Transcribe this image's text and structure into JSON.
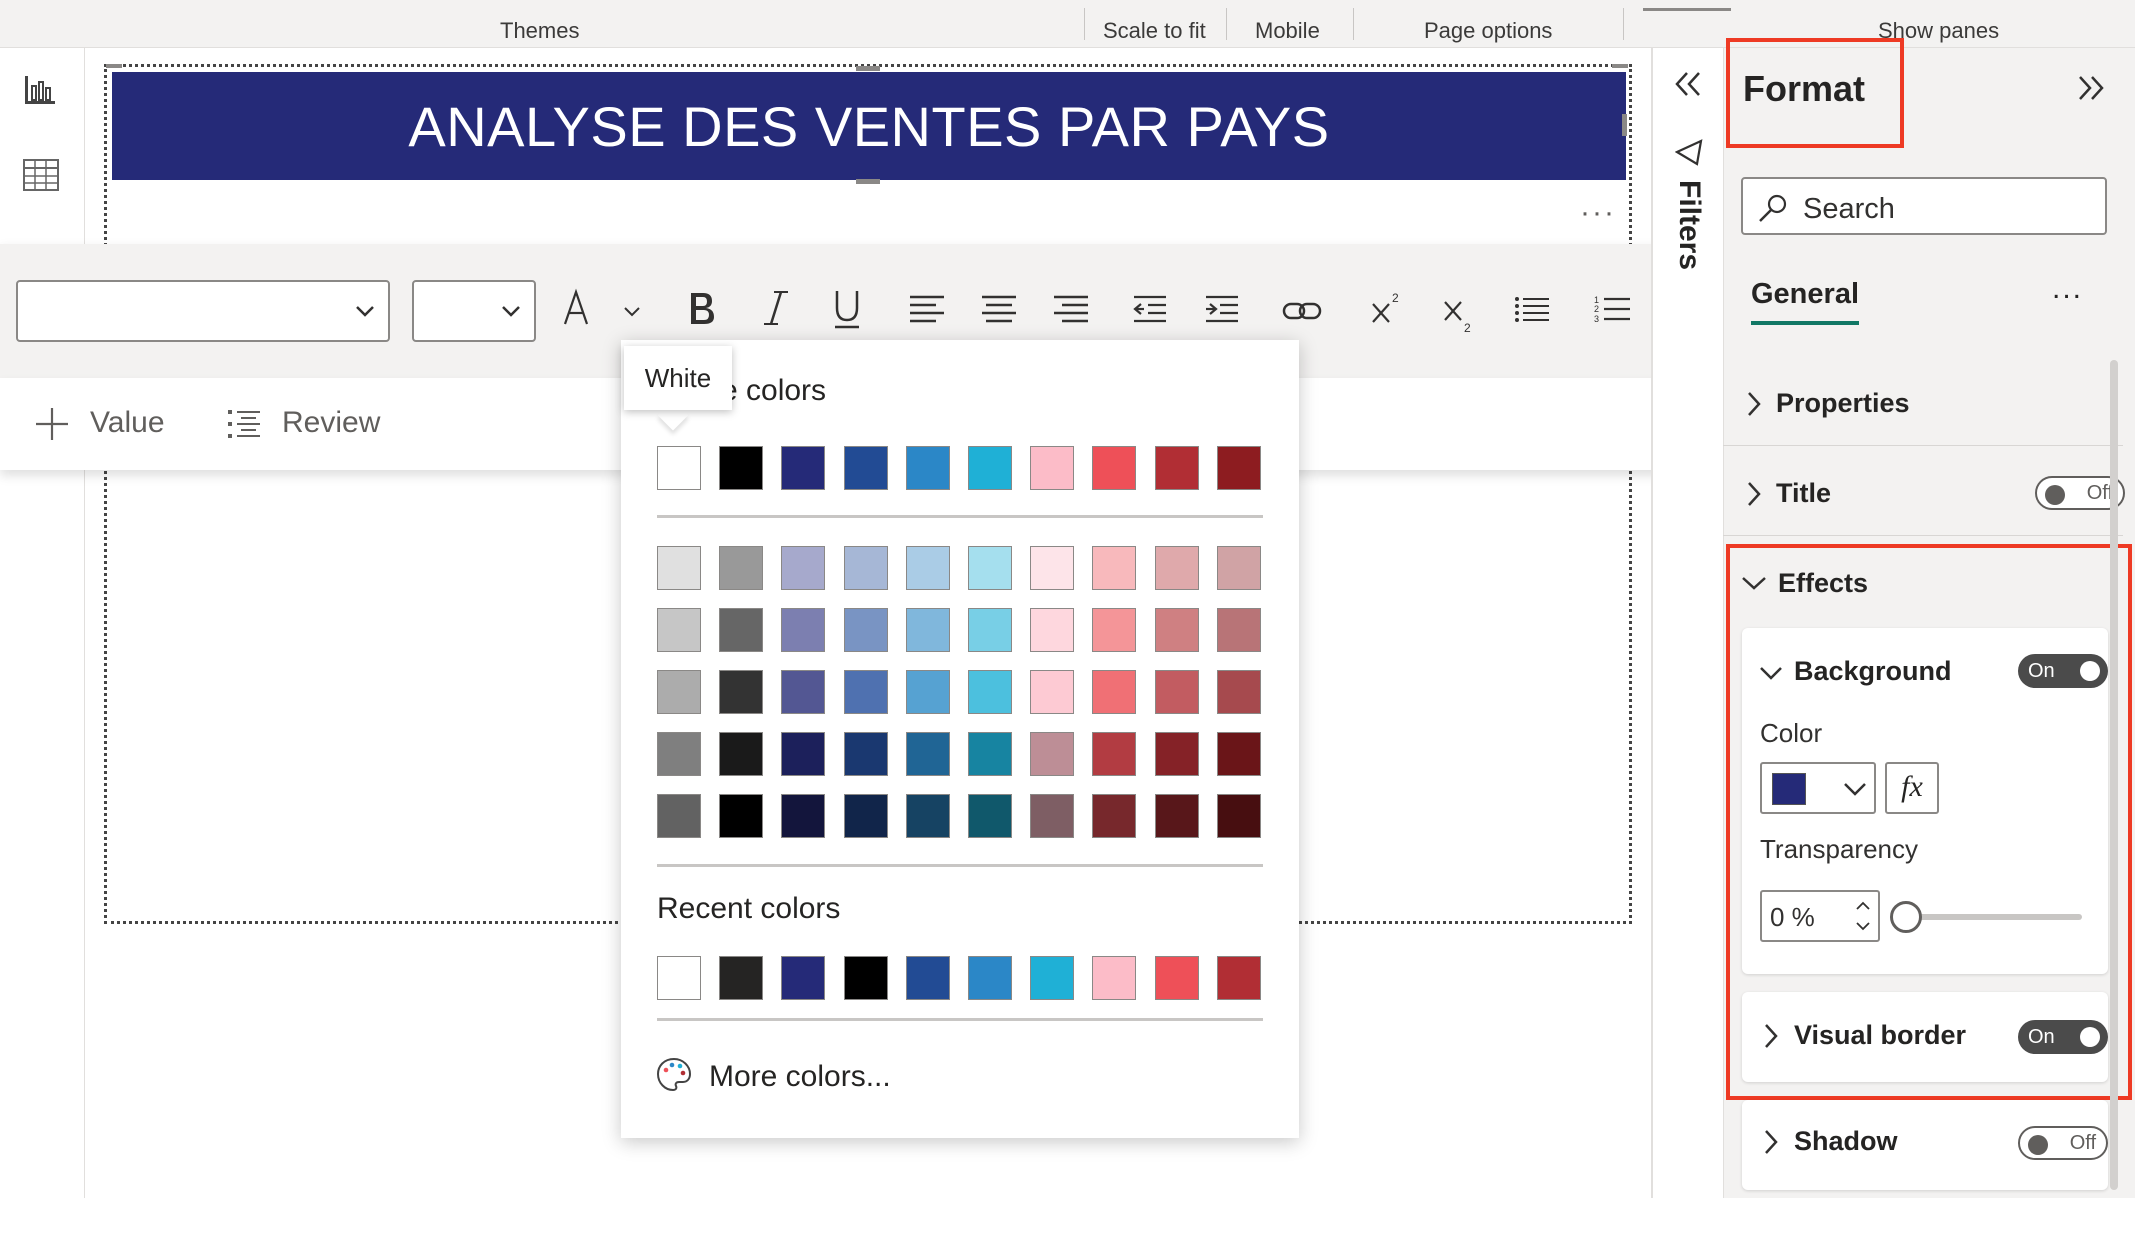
{
  "ribbon": {
    "themes": "Themes",
    "scale_to_fit": "Scale to fit",
    "mobile": "Mobile",
    "page_options": "Page options",
    "show_panes": "Show panes"
  },
  "canvas": {
    "banner_title": "ANALYSE DES VENTES PAR PAYS",
    "banner_color": "#252a78"
  },
  "toolbar": {
    "font_family_value": "",
    "font_size_value": "",
    "value_button": "Value",
    "review_button": "Review"
  },
  "color_picker": {
    "tooltip": "White",
    "theme_colors_title": "Theme colors",
    "theme_colors_visible_title": "e colors",
    "theme_top_row": [
      "#ffffff",
      "#000000",
      "#252a78",
      "#224b94",
      "#2b87c7",
      "#1fb0d6",
      "#fcbcc8",
      "#ee5058",
      "#b12e34",
      "#8d1c20"
    ],
    "theme_shades": [
      [
        "#e0e0e0",
        "#999999",
        "#a6a9cc",
        "#a6b7d6",
        "#aacce6",
        "#a5dfee",
        "#fde4e9",
        "#f8b9bc",
        "#dfa9ab",
        "#d0a3a5"
      ],
      [
        "#c6c6c6",
        "#666666",
        "#7c7fb0",
        "#7994c3",
        "#80b7dc",
        "#78cfe6",
        "#fed7de",
        "#f49598",
        "#cf8082",
        "#b87477"
      ],
      [
        "#acacac",
        "#333333",
        "#535793",
        "#4f71b0",
        "#56a2d2",
        "#4cc0de",
        "#fdcad3",
        "#f07075",
        "#c25c61",
        "#a64a4e"
      ],
      [
        "#7f7f7f",
        "#1a1a1a",
        "#1c205b",
        "#1a3870",
        "#206595",
        "#1784a1",
        "#bd8e96",
        "#b23c42",
        "#852227",
        "#6a1518"
      ],
      [
        "#626262",
        "#000000",
        "#13153c",
        "#11254a",
        "#164363",
        "#10586b",
        "#7e5e64",
        "#77282c",
        "#58171a",
        "#470e10"
      ]
    ],
    "recent_colors_title": "Recent colors",
    "recent_colors": [
      "#ffffff",
      "#252423",
      "#252a78",
      "#000000",
      "#224b94",
      "#2b87c7",
      "#1fb0d6",
      "#fcbcc8",
      "#ee5058",
      "#b12e34"
    ],
    "more_colors": "More colors..."
  },
  "filters": {
    "label": "Filters"
  },
  "format_pane": {
    "title": "Format",
    "search_placeholder": "Search",
    "tab_general": "General",
    "more": "...",
    "properties": "Properties",
    "title_row": "Title",
    "title_toggle": "Off",
    "effects": "Effects",
    "background": "Background",
    "background_toggle": "On",
    "color_label": "Color",
    "color_value": "#252a78",
    "fx_label": "fx",
    "transparency_label": "Transparency",
    "transparency_value": "0 %",
    "transparency_slider": 0,
    "visual_border": "Visual border",
    "visual_border_toggle": "On",
    "shadow": "Shadow",
    "shadow_toggle": "Off"
  }
}
